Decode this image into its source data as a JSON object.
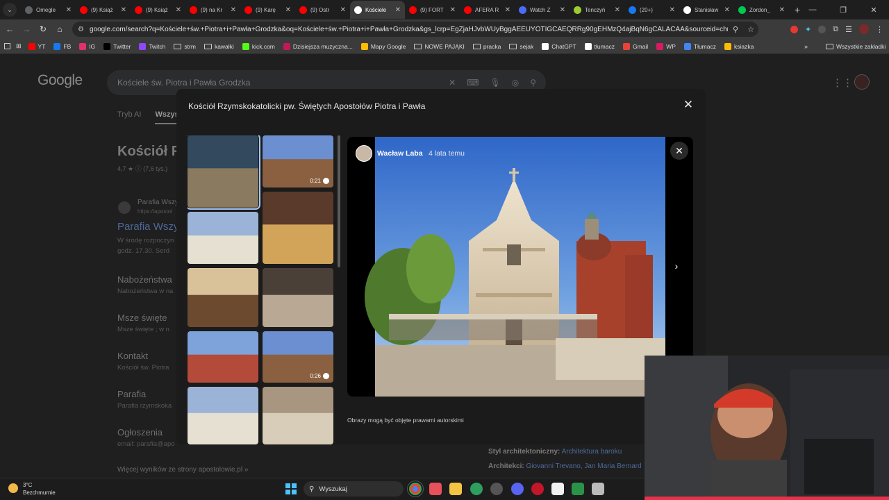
{
  "tabs": [
    {
      "label": "Omegle",
      "color": "#5f6368",
      "icon": "omegle-icon"
    },
    {
      "label": "(9) Książ",
      "color": "#ff0000",
      "icon": "youtube-icon"
    },
    {
      "label": "(9) Książ",
      "color": "#ff0000",
      "icon": "youtube-icon"
    },
    {
      "label": "(9) na Kr",
      "color": "#ff0000",
      "icon": "youtube-icon"
    },
    {
      "label": "(9) Karę",
      "color": "#ff0000",
      "icon": "youtube-icon"
    },
    {
      "label": "(9) Ostr",
      "color": "#ff0000",
      "icon": "youtube-icon"
    },
    {
      "label": "Kościele",
      "color": "#ffffff",
      "icon": "google-icon",
      "active": true
    },
    {
      "label": "(9) FORT",
      "color": "#ff0000",
      "icon": "youtube-icon"
    },
    {
      "label": "AFERA R",
      "color": "#ff0000",
      "icon": "youtube-icon"
    },
    {
      "label": "Watch Z",
      "color": "#4a6cf7",
      "icon": "watch-icon"
    },
    {
      "label": "Tenczyń",
      "color": "#9acd32",
      "icon": "site-icon"
    },
    {
      "label": "(20+)",
      "color": "#1877f2",
      "icon": "facebook-icon"
    },
    {
      "label": "Stanisław",
      "color": "#ffffff",
      "icon": "wikipedia-icon"
    },
    {
      "label": "Zordon_",
      "color": "#00c853",
      "icon": "site-icon"
    }
  ],
  "address_bar": {
    "url": "google.com/search?q=Kościele+św.+Piotra+i+Pawła+Grodzka&oq=Kościele+św.+Piotra+i+Pawła+Grodzka&gs_lcrp=EgZjaHJvbWUyBggAEEUYOTIGCAEQRRg90gEHMzQ4ajBqN6gCALACAA&sourceid=chrome&ie=UTF-8"
  },
  "bookmarks": [
    {
      "label": "YT",
      "icon": "youtube-icon",
      "color": "#ff0000"
    },
    {
      "label": "FB",
      "icon": "facebook-icon",
      "color": "#1877f2"
    },
    {
      "label": "IG",
      "icon": "instagram-icon",
      "color": "#e1306c"
    },
    {
      "label": "Twitter",
      "icon": "x-icon",
      "color": "#000000"
    },
    {
      "label": "Twitch",
      "icon": "twitch-icon",
      "color": "#9146ff"
    },
    {
      "label": "strm",
      "icon": "folder-icon",
      "color": ""
    },
    {
      "label": "kawałki",
      "icon": "folder-icon",
      "color": ""
    },
    {
      "label": "kick.com",
      "icon": "kick-icon",
      "color": "#53fc18"
    },
    {
      "label": "Dzisiejsza muzyczna...",
      "icon": "site-icon",
      "color": "#c2185b"
    },
    {
      "label": "Mapy Google",
      "icon": "maps-icon",
      "color": "#fbbc04"
    },
    {
      "label": "NOWE PAJĄKI",
      "icon": "folder-icon",
      "color": ""
    },
    {
      "label": "pracka",
      "icon": "folder-icon",
      "color": ""
    },
    {
      "label": "sejak",
      "icon": "folder-icon",
      "color": ""
    },
    {
      "label": "ChatGPT",
      "icon": "chatgpt-icon",
      "color": "#ffffff"
    },
    {
      "label": "tłumacz",
      "icon": "translate-icon",
      "color": "#ffffff"
    },
    {
      "label": "Gmail",
      "icon": "gmail-icon",
      "color": "#ea4335"
    },
    {
      "label": "WP",
      "icon": "wp-icon",
      "color": "#d81b60"
    },
    {
      "label": "Tłumacz",
      "icon": "translate-icon",
      "color": "#4285f4"
    },
    {
      "label": "ksiazka",
      "icon": "site-icon",
      "color": "#fbbc04"
    }
  ],
  "bookmarks_all": "Wszystkie zakładki",
  "google": {
    "logo": "Google",
    "query": "Kościele św. Piotra i Pawła Grodzka",
    "tabs": [
      "Tryb AI",
      "Wszyst"
    ],
    "kp_title": "Kościół R",
    "kp_rating": "4,7 ★  ⓘ (7,6 tys.)",
    "result_site": "Parafia Wszy",
    "result_url": "https://apostol",
    "result_title": "Parafia Wszy",
    "result_snippet_1": "W środę rozpoczyn",
    "result_snippet_2": "godz. 17.30. Serd",
    "sitelinks": [
      {
        "title": "Nabożeństwa",
        "snippet": "Nabożeństwa w na"
      },
      {
        "title": "Msze święte",
        "snippet": "Msze święte ; w n"
      },
      {
        "title": "Kontakt",
        "snippet": "Kościół św. Piotra"
      },
      {
        "title": "Parafia",
        "snippet": "Parafia rzymskoka"
      },
      {
        "title": "Ogłoszenia",
        "snippet": "email: parafia@apo"
      }
    ],
    "more_results": "Więcej wyników ze strony apostolowie.pl »",
    "kp_style_label": "Styl architektoniczny:",
    "kp_style_value": "Architektura baroku",
    "kp_arch_label": "Architekci:",
    "kp_arch_value": "Giovanni Trevano, Jan Maria Bernard"
  },
  "modal": {
    "title": "Kościół Rzymskokatolicki pw. Świętych Apostołów Piotra i Pawła",
    "thumbnails": [
      {
        "kind": "church-facade-dusk",
        "selected": true
      },
      {
        "kind": "tower-video",
        "duration": "0:21"
      },
      {
        "kind": "church-facade-day"
      },
      {
        "kind": "altar-interior"
      },
      {
        "kind": "nave-interior"
      },
      {
        "kind": "sculpture-interior"
      },
      {
        "kind": "red-brick-exterior"
      },
      {
        "kind": "tower-video",
        "duration": "0:26"
      },
      {
        "kind": "church-facade-day"
      },
      {
        "kind": "sarcophagus"
      }
    ],
    "author_name": "Wacław Laba",
    "author_time": "4 lata temu",
    "copyright": "Obrazy mogą być objęte prawami autorskimi"
  },
  "taskbar": {
    "temperature": "3°C",
    "weather": "Bezchmurnie",
    "search_label": "Wyszukaj"
  }
}
